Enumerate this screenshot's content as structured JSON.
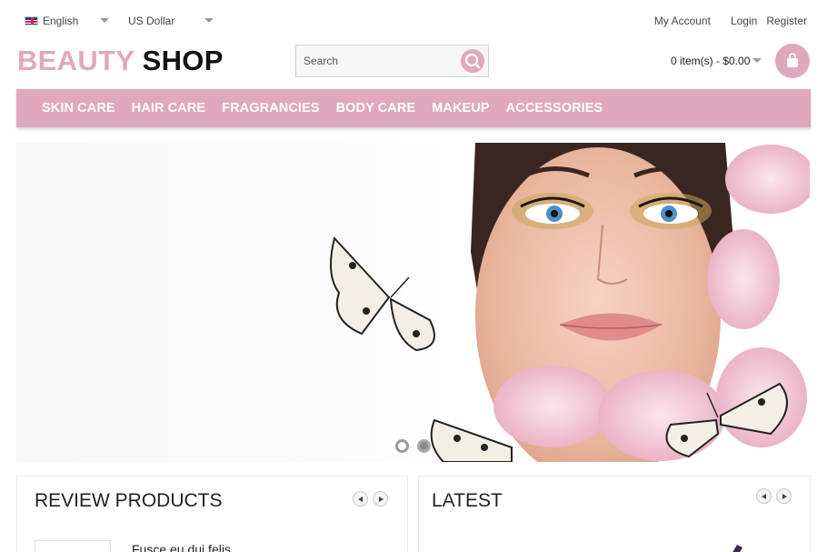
{
  "topbar": {
    "language": "English",
    "currency": "US Dollar",
    "links": {
      "my_account": "My Account",
      "login": "Login",
      "register": "Register"
    }
  },
  "header": {
    "logo_part1": "BEAUTY",
    "logo_part2": "SHOP",
    "search_placeholder": "Search",
    "cart_summary": "0 item(s) - $0.00"
  },
  "nav": {
    "items": [
      "SKIN CARE",
      "HAIR CARE",
      "FRAGRANCIES",
      "BODY CARE",
      "MAKEUP",
      "ACCESSORIES"
    ]
  },
  "slider": {
    "slide_count": 2,
    "active_slide": 2
  },
  "sections": {
    "review": {
      "title": "REVIEW PRODUCTS",
      "first_product": "Fusce eu dui felis"
    },
    "latest": {
      "title": "LATEST"
    }
  },
  "colors": {
    "brand_pink": "#e0a8bd",
    "logo_dark": "#111111",
    "nav_text": "#ffffff"
  },
  "icons": [
    "flag-uk-icon",
    "chevron-down-icon",
    "search-icon",
    "shopping-bag-icon",
    "arrow-left-icon",
    "arrow-right-icon"
  ]
}
